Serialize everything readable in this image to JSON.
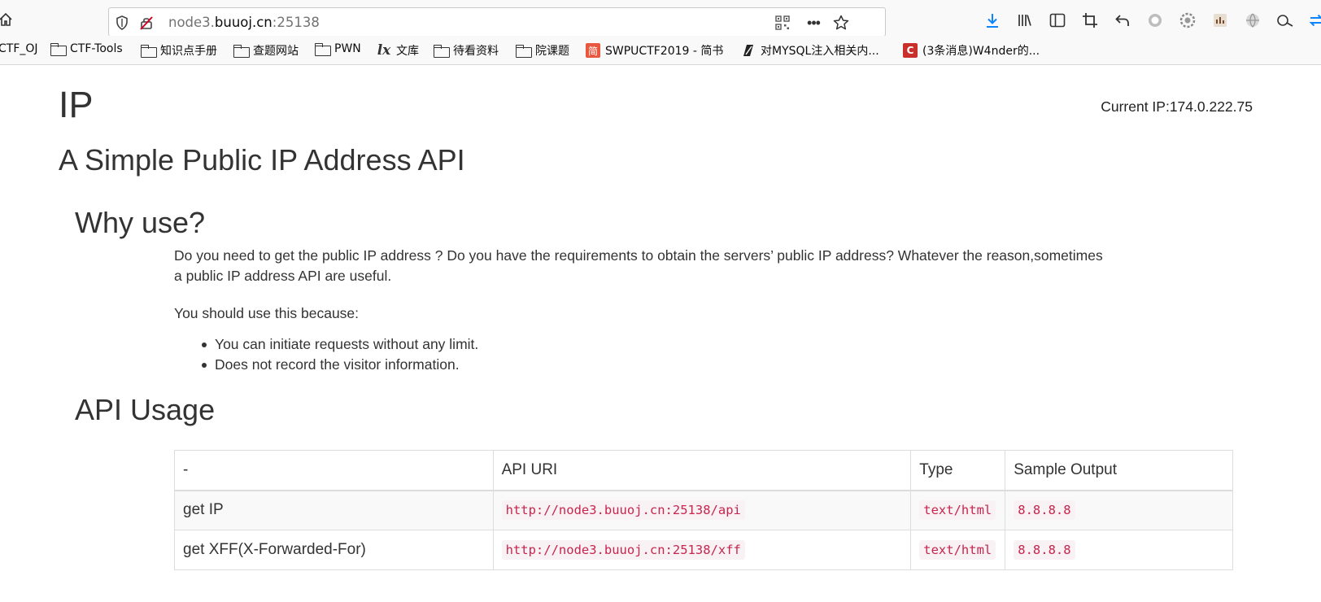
{
  "browser": {
    "url_prefix": "node3.",
    "url_host": "buuoj.cn",
    "url_suffix": ":25138",
    "bookmarks": [
      {
        "label": "CTF_OJ",
        "icon": "folder-icon"
      },
      {
        "label": "CTF-Tools",
        "icon": "folder-icon"
      },
      {
        "label": "知识点手册",
        "icon": "folder-icon"
      },
      {
        "label": "查题网站",
        "icon": "folder-icon"
      },
      {
        "label": "PWN",
        "icon": "folder-icon"
      },
      {
        "label": "文库",
        "icon": "lx-icon"
      },
      {
        "label": "待看资料",
        "icon": "folder-icon"
      },
      {
        "label": "院课题",
        "icon": "folder-icon"
      },
      {
        "label": "SWPUCTF2019 - 简书",
        "icon": "jianshu-icon",
        "badge": "简"
      },
      {
        "label": "对MYSQL注入相关内...",
        "icon": "z-icon"
      },
      {
        "label": "(3条消息)W4nder的...",
        "icon": "csdn-icon",
        "badge": "C"
      }
    ]
  },
  "page": {
    "title": "IP",
    "current_ip": "Current IP:174.0.222.75",
    "subtitle": "A Simple Public IP Address API",
    "why_heading": "Why use?",
    "why_paragraph": "Do you need to get the public IP address ? Do you have the requirements to obtain the servers’ public IP address? Whatever the reason,sometimes a public IP address API are useful.",
    "because": "You should use this because:",
    "reasons": [
      "You can initiate requests without any limit.",
      "Does not record the visitor information."
    ],
    "api_heading": "API Usage",
    "table": {
      "headers": [
        "-",
        "API URI",
        "Type",
        "Sample Output"
      ],
      "rows": [
        [
          "get IP",
          "http://node3.buuoj.cn:25138/api",
          "text/html",
          "8.8.8.8"
        ],
        [
          "get XFF(X-Forwarded-For)",
          "http://node3.buuoj.cn:25138/xff",
          "text/html",
          "8.8.8.8"
        ]
      ]
    }
  },
  "colors": {
    "code_text": "#c7254e",
    "code_bg": "#f9f2f4",
    "download_icon": "#0a84ff",
    "jianshu_badge": "#e9573f",
    "csdn_badge": "#c9302c"
  }
}
